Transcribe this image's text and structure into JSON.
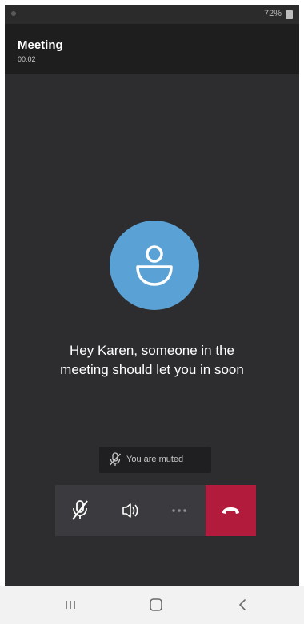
{
  "status_bar": {
    "battery": "72%"
  },
  "header": {
    "title": "Meeting",
    "timer": "00:02"
  },
  "lobby": {
    "avatar_icon": "person-icon",
    "message_line1": "Hey Karen, someone in the",
    "message_line2": "meeting should let you in soon"
  },
  "toast": {
    "icon": "mic-off-icon",
    "text": "You are muted"
  },
  "controls": {
    "mute": {
      "icon": "mic-off-icon",
      "state": "muted"
    },
    "speaker": {
      "icon": "speaker-icon"
    },
    "more": {
      "icon": "more-options-icon"
    },
    "hangup": {
      "icon": "hang-up-icon",
      "color": "#b31b3c"
    }
  },
  "nav": {
    "recent": {
      "icon": "recent-apps-icon"
    },
    "home": {
      "icon": "home-icon"
    },
    "back": {
      "icon": "back-icon"
    }
  },
  "colors": {
    "background": "#2d2d30",
    "header": "#1e1e1e",
    "avatar": "#5aa2d6",
    "hangup": "#b31b3c"
  }
}
